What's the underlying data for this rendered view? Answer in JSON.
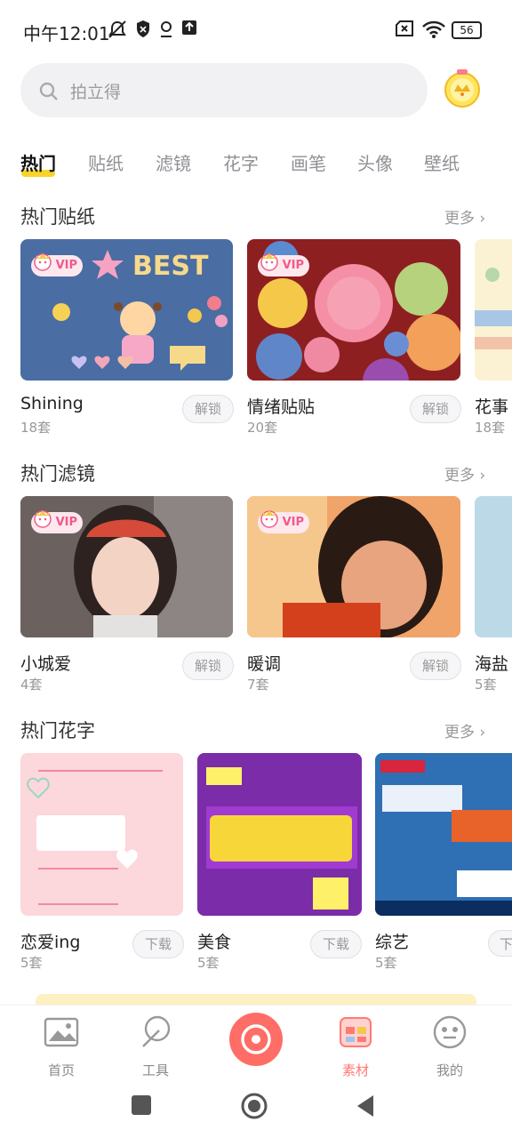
{
  "status_bar": {
    "time": "中午12:01",
    "battery": "56"
  },
  "search": {
    "placeholder": "拍立得"
  },
  "tabs": [
    "热门",
    "贴纸",
    "滤镜",
    "花字",
    "画笔",
    "头像",
    "壁纸"
  ],
  "sections": {
    "stickers": {
      "title": "热门贴纸",
      "more": "更多",
      "items": [
        {
          "name": "Shining",
          "count": "18套",
          "action": "解锁",
          "vip": "VIP"
        },
        {
          "name": "情绪贴贴",
          "count": "20套",
          "action": "解锁",
          "vip": "VIP"
        },
        {
          "name": "花事",
          "count": "18套"
        }
      ]
    },
    "filters": {
      "title": "热门滤镜",
      "more": "更多",
      "items": [
        {
          "name": "小城爱",
          "count": "4套",
          "action": "解锁",
          "vip": "VIP"
        },
        {
          "name": "暖调",
          "count": "7套",
          "action": "解锁",
          "vip": "VIP"
        },
        {
          "name": "海盐",
          "count": "5套"
        }
      ]
    },
    "fonts": {
      "title": "热门花字",
      "more": "更多",
      "items": [
        {
          "name": "恋爱ing",
          "count": "5套",
          "action": "下载"
        },
        {
          "name": "美食",
          "count": "5套",
          "action": "下载"
        },
        {
          "name": "综艺",
          "count": "5套",
          "action": "下"
        }
      ]
    }
  },
  "bottom_nav": {
    "items": [
      {
        "label": "首页",
        "icon": "photo-icon"
      },
      {
        "label": "工具",
        "icon": "tools-icon"
      },
      {
        "label": "",
        "icon": "camera-icon"
      },
      {
        "label": "素材",
        "icon": "materials-icon",
        "active": true
      },
      {
        "label": "我的",
        "icon": "profile-face-icon"
      }
    ]
  },
  "colors": {
    "accent": "#ff6e66",
    "tab_underline": "#f7d42b",
    "vip_text": "#f05a8c"
  }
}
